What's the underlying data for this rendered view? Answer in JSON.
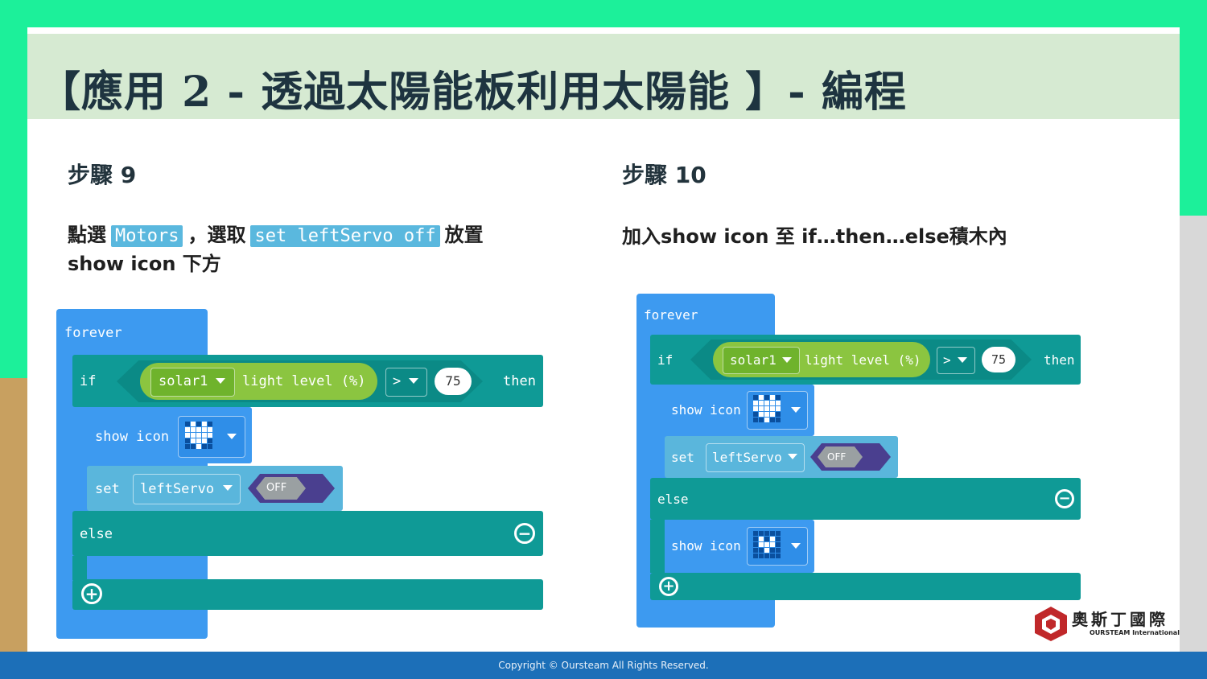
{
  "title": "【應用 2 - 透過太陽能板利用太陽能 】- 編程",
  "step9": {
    "heading": "步驟 9",
    "desc_prefix": "點選",
    "chip1": "Motors",
    "desc_mid": "，選取",
    "chip2": "set leftServo off",
    "desc_suffix": "放置",
    "desc_line2": "show icon 下方"
  },
  "step10": {
    "heading": "步驟 10",
    "desc": "加入show icon 至 if…then…else積木內"
  },
  "blocks": {
    "forever": "forever",
    "if": "if",
    "solar": "solar1",
    "light_level": "light level (%)",
    "op": ">",
    "value": "75",
    "then": "then",
    "show_icon": "show icon",
    "set": "set",
    "servo": "leftServo",
    "off": "OFF",
    "else": "else",
    "minus": "−",
    "plus": "+"
  },
  "icons": {
    "heart_pattern": [
      0,
      1,
      0,
      1,
      0,
      1,
      1,
      1,
      1,
      1,
      1,
      1,
      1,
      1,
      1,
      0,
      1,
      1,
      1,
      0,
      0,
      0,
      1,
      0,
      0
    ],
    "small_heart_pattern": [
      0,
      0,
      0,
      0,
      0,
      0,
      1,
      0,
      1,
      0,
      0,
      1,
      1,
      1,
      0,
      0,
      0,
      1,
      0,
      0,
      0,
      0,
      0,
      0,
      0
    ]
  },
  "logo": {
    "name": "奧斯丁國際",
    "sub": "OURSTEAM International"
  },
  "footer": "Copyright © Oursteam All Rights Reserved.",
  "colors": {
    "loops": "#3d9af0",
    "logic": "#0f9a96",
    "motors": "#5ab6dc",
    "sensor": "#8bc540",
    "bar": "#1c6fb8"
  }
}
